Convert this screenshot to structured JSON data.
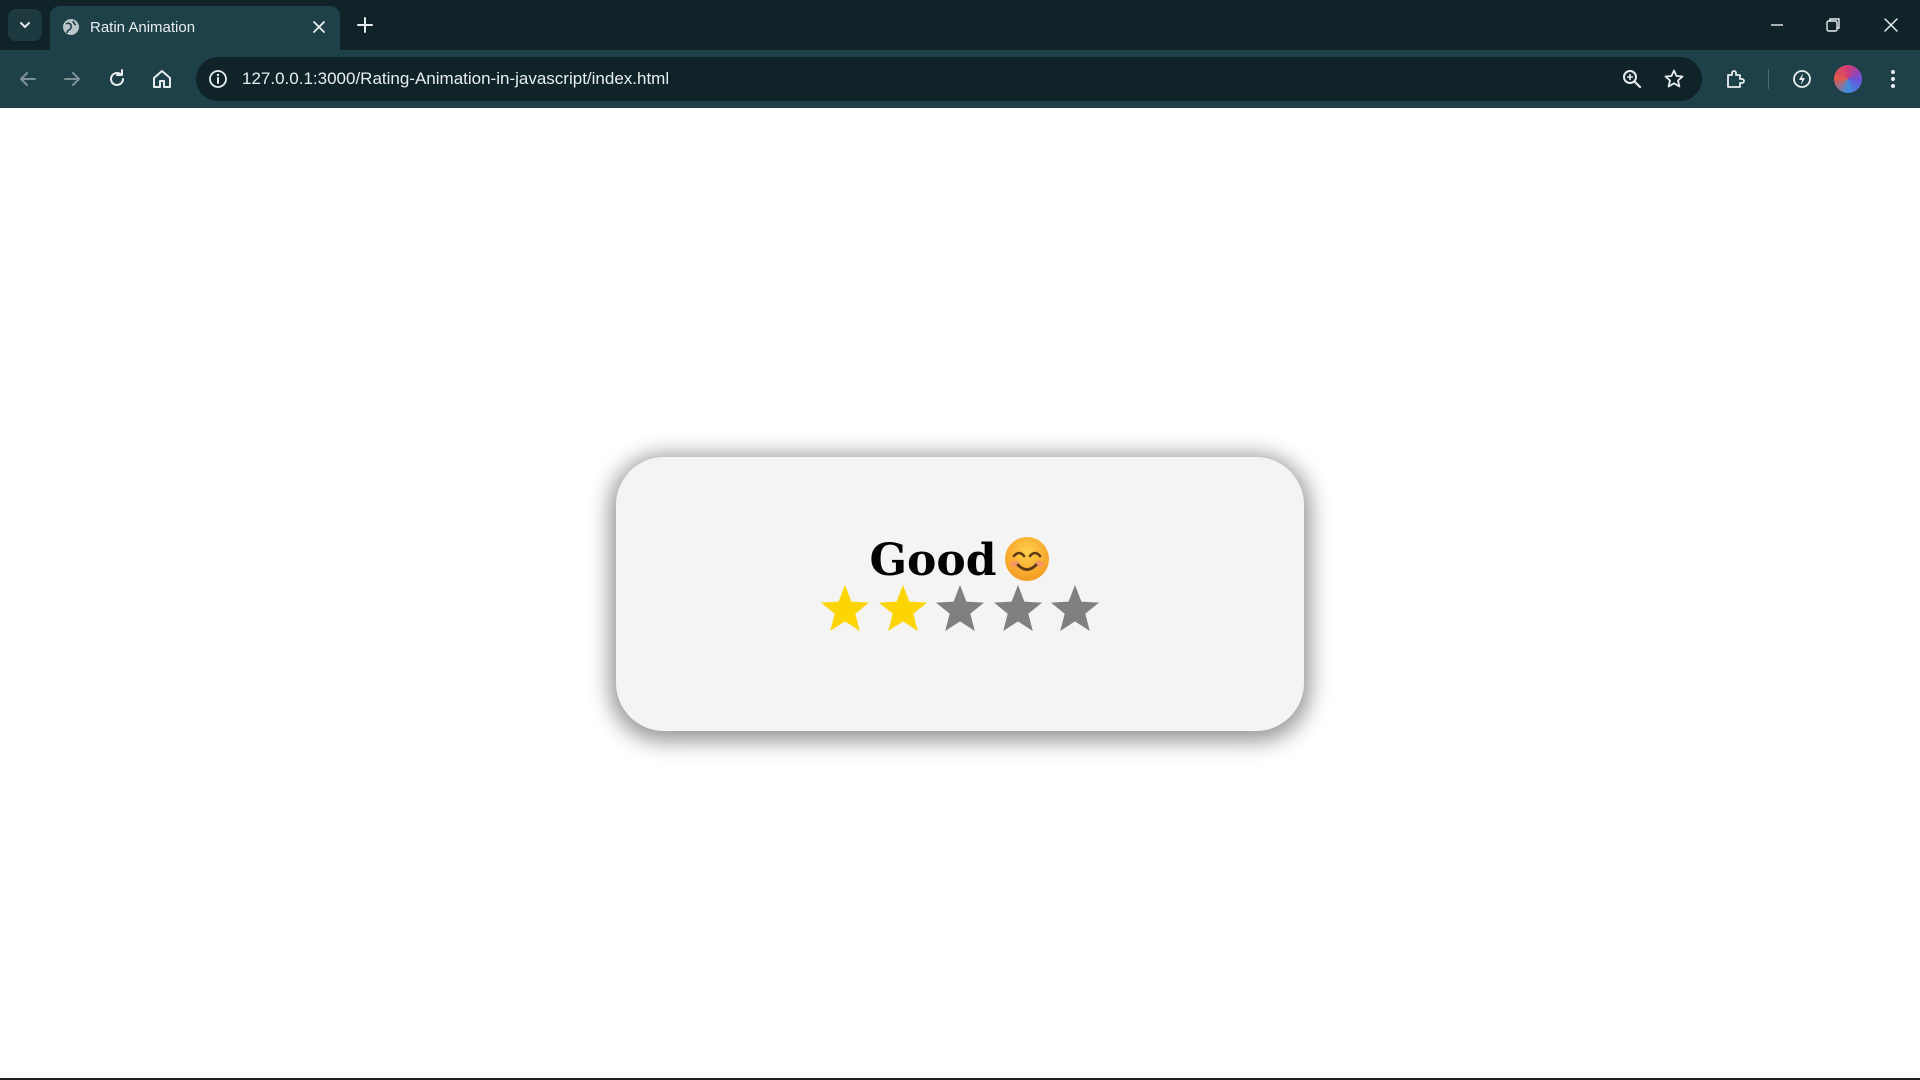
{
  "browser": {
    "tab_title": "Ratin Animation",
    "url": "127.0.0.1:3000/Rating-Animation-in-javascript/index.html",
    "icons": {
      "tab_search": "chevron-down-icon",
      "favicon": "globe-icon",
      "tab_close": "close-icon",
      "new_tab": "plus-icon",
      "minimize": "minimize-icon",
      "restore": "restore-icon",
      "close_window": "close-icon",
      "back": "back-arrow-icon",
      "forward": "forward-arrow-icon",
      "reload": "reload-icon",
      "home": "home-icon",
      "site_info": "info-icon",
      "zoom": "zoom-icon",
      "bookmark": "star-outline-icon",
      "extensions": "puzzle-icon",
      "performance": "speed-icon",
      "profile": "avatar",
      "menu": "kebab-menu-icon"
    }
  },
  "rating": {
    "label": "Good",
    "emoji": "smiling-face-icon",
    "value": 2,
    "max": 5,
    "active_color": "#fed500",
    "inactive_color": "#808080"
  },
  "colors": {
    "titlebar": "#0f2329",
    "toolbar": "#1e4048",
    "card": "#f4f4f4"
  }
}
